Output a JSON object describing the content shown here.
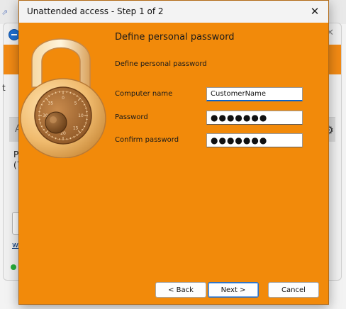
{
  "background": {
    "text_fragment_t": "t",
    "panel_letter": "A",
    "text_line1": "Pl",
    "text_line2": "(7",
    "link_fragment": "ww"
  },
  "dialog": {
    "title": "Unattended access - Step 1 of 2",
    "heading": "Define personal password",
    "subheading": "Define personal password",
    "fields": {
      "computer_name": {
        "label": "Computer name",
        "value": "CustomerName"
      },
      "password": {
        "label": "Password",
        "value": "●●●●●●●"
      },
      "confirm_password": {
        "label": "Confirm password",
        "value": "●●●●●●●"
      }
    },
    "buttons": {
      "back": "< Back",
      "next": "Next >",
      "cancel": "Cancel"
    },
    "dial_numbers": [
      "0",
      "5",
      "10",
      "15",
      "20",
      "25",
      "30",
      "35"
    ]
  },
  "colors": {
    "accent_orange": "#f28a0a",
    "focus_blue": "#0b63c9"
  }
}
